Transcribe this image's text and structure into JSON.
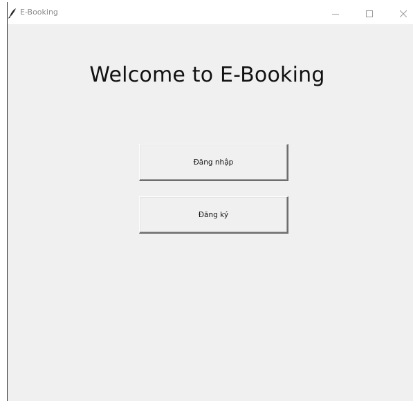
{
  "window": {
    "title": "E-Booking",
    "controls": {
      "minimize": "minimize-icon",
      "maximize": "maximize-icon",
      "close": "close-icon"
    }
  },
  "main": {
    "heading": "Welcome to E-Booking",
    "buttons": {
      "login_label": "Đăng nhập",
      "register_label": "Đăng ký"
    }
  },
  "colors": {
    "window_bg": "#f0f0f0",
    "titlebar_bg": "#ffffff",
    "title_text": "#8a8a8a"
  }
}
